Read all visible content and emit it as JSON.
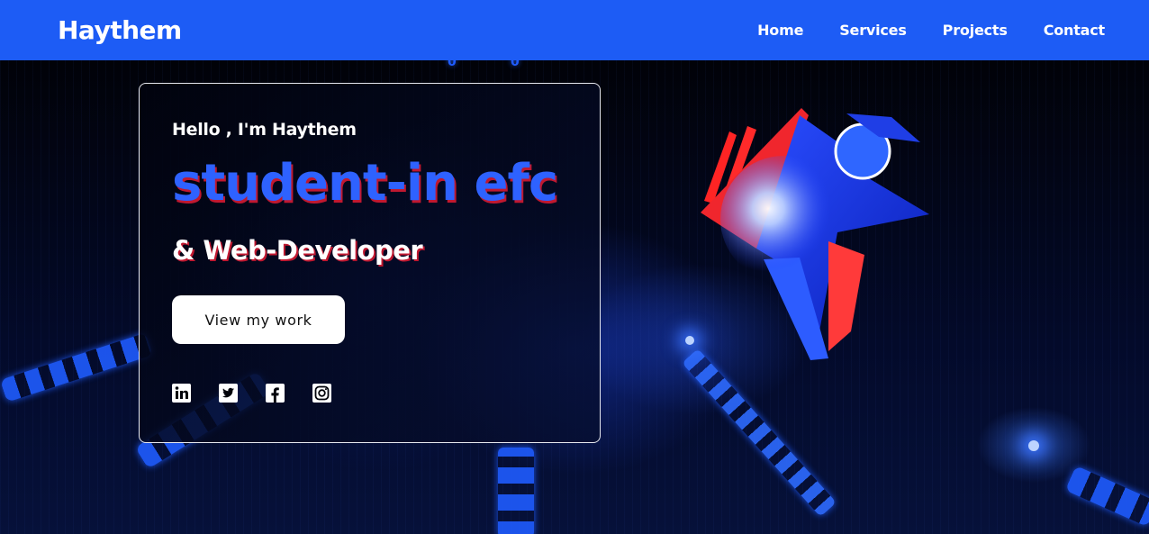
{
  "header": {
    "brand": "Haythem",
    "nav": [
      {
        "label": "Home"
      },
      {
        "label": "Services"
      },
      {
        "label": "Projects"
      },
      {
        "label": "Contact"
      }
    ]
  },
  "hero": {
    "greeting": "Hello , I'm Haythem",
    "role_primary": "student-in efc",
    "role_secondary": "& Web-Developer",
    "cta_label": "View my work",
    "socials": [
      {
        "icon": "linkedin-icon"
      },
      {
        "icon": "twitter-icon"
      },
      {
        "icon": "facebook-icon"
      },
      {
        "icon": "instagram-icon"
      }
    ]
  },
  "colors": {
    "header_bg": "#1d5cf5",
    "accent_blue": "#2e62ff",
    "accent_red": "#c01830",
    "background": "#02030a"
  }
}
